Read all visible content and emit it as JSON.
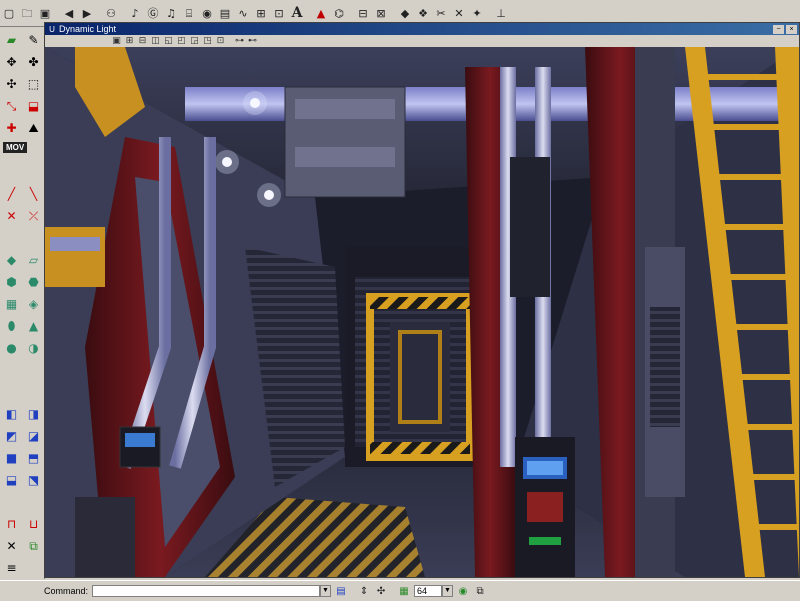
{
  "toolbar": {
    "icons": [
      "new-file-icon",
      "open-folder-icon",
      "save-icon",
      "back-icon",
      "forward-icon",
      "binoculars-icon",
      "sound-icon",
      "texture-icon",
      "music-icon",
      "mesh-icon",
      "actor-icon",
      "image-icon",
      "wave-icon",
      "group-icon",
      "camera-icon",
      "font-icon",
      "rebuild-geometry-icon",
      "rebuild-all-icon",
      "play-level-icon",
      "lighting-icon",
      "paths-icon",
      "scissors-icon",
      "settings-icon",
      "joystick-icon"
    ],
    "font_glyph": "A"
  },
  "palette": {
    "mov_label": "MOV"
  },
  "viewport": {
    "title": "Dynamic Light",
    "window_buttons": [
      "−",
      "×"
    ]
  },
  "statusbar": {
    "command_label": "Command:",
    "command_value": "",
    "grid_size": "64"
  },
  "colors": {
    "chrome": "#d4d0c8",
    "titlebar_start": "#0a246a",
    "titlebar_end": "#3a6ea5"
  }
}
